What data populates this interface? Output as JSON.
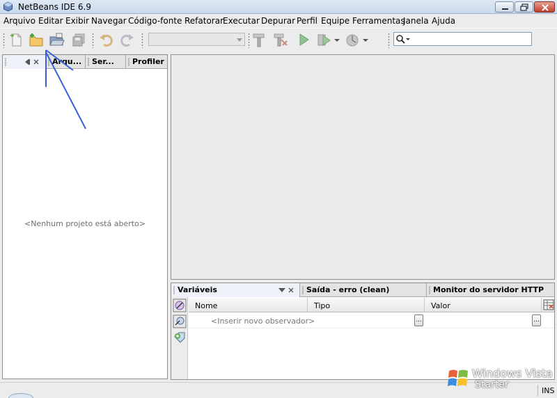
{
  "window": {
    "title": "NetBeans IDE 6.9"
  },
  "menu": {
    "items": [
      "Arquivo",
      "Editar",
      "Exibir",
      "Navegar",
      "Código-fonte",
      "Refatorar",
      "Executar",
      "Depurar",
      "Perfil",
      "Equipe",
      "Ferramentas",
      "Janela",
      "Ajuda"
    ]
  },
  "toolbar": {
    "buttons": [
      "new-file-icon",
      "new-project-icon",
      "open-project-icon",
      "save-all-icon",
      "undo-icon",
      "redo-icon",
      "build-icon",
      "clean-build-icon",
      "run-icon",
      "debug-icon",
      "profile-icon"
    ],
    "config_combo_value": "",
    "search_placeholder": ""
  },
  "left_panel": {
    "tabs": [
      "Arqu...",
      "Ser...",
      "Profiler"
    ],
    "empty_message": "<Nenhum projeto está aberto>"
  },
  "bottom_panel": {
    "tabs": [
      "Variáveis",
      "Saída - erro (clean)",
      "Monitor do servidor HTTP"
    ],
    "columns": [
      "Nome",
      "Tipo",
      "Valor"
    ],
    "new_watch_placeholder": "<Inserir novo observador>",
    "ellipsis": "..."
  },
  "status": {
    "insert_mode": "INS"
  },
  "watermark": {
    "line1": "Windows Vista",
    "line2": "Starter"
  },
  "colors": {
    "annotation_arrow": "#3a5fd9",
    "titlebar": "#c9d9ec",
    "panel_border": "#8e8e8e"
  }
}
